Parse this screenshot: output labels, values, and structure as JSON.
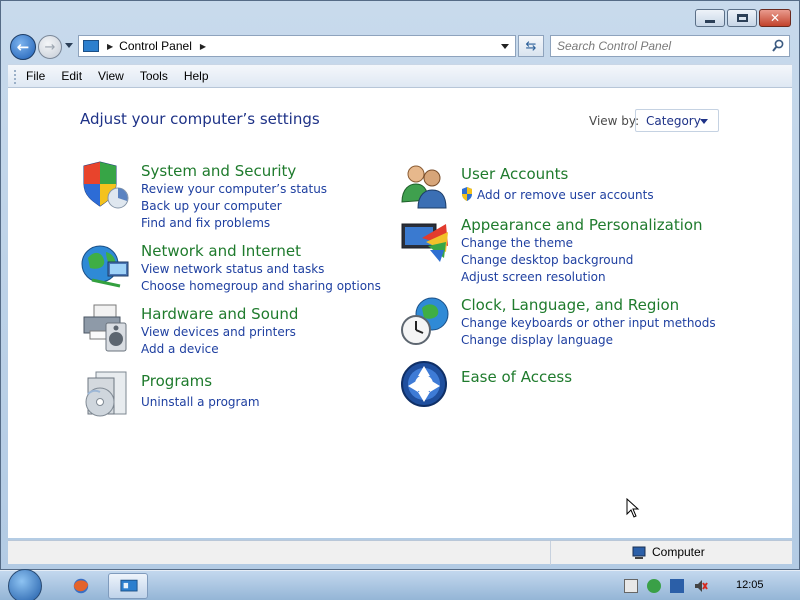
{
  "window": {
    "caption_buttons": [
      "minimize",
      "maximize",
      "close"
    ]
  },
  "address_bar": {
    "path": "Control Panel",
    "search_placeholder": "Search Control Panel"
  },
  "menu": {
    "items": [
      "File",
      "Edit",
      "View",
      "Tools",
      "Help"
    ]
  },
  "content": {
    "heading": "Adjust your computer’s settings",
    "view_by_label": "View by:",
    "view_by_value": "Category",
    "categories": [
      {
        "title": "System and Security",
        "icon": "shield-icon",
        "links": [
          "Review your computer’s status",
          "Back up your computer",
          "Find and fix problems"
        ]
      },
      {
        "title": "Network and Internet",
        "icon": "network-globe-icon",
        "links": [
          "View network status and tasks",
          "Choose homegroup and sharing options"
        ]
      },
      {
        "title": "Hardware and Sound",
        "icon": "printer-speaker-icon",
        "links": [
          "View devices and printers",
          "Add a device"
        ]
      },
      {
        "title": "Programs",
        "icon": "programs-disc-icon",
        "links": [
          "Uninstall a program"
        ]
      },
      {
        "title": "User Accounts",
        "icon": "users-icon",
        "links": [
          "Add or remove user accounts"
        ]
      },
      {
        "title": "Appearance and Personalization",
        "icon": "monitor-palette-icon",
        "links": [
          "Change the theme",
          "Change desktop background",
          "Adjust screen resolution"
        ]
      },
      {
        "title": "Clock, Language, and Region",
        "icon": "clock-globe-icon",
        "links": [
          "Change keyboards or other input methods",
          "Change display language"
        ]
      },
      {
        "title": "Ease of Access",
        "icon": "ease-of-access-icon",
        "links": []
      }
    ]
  },
  "status_bar": {
    "location": "Computer"
  },
  "taskbar": {
    "clock": "12:05"
  },
  "colors": {
    "category_title": "#1f7b2d",
    "link": "#1e3fa0",
    "heading": "#1e3287",
    "frame": "#b9d1ea"
  }
}
